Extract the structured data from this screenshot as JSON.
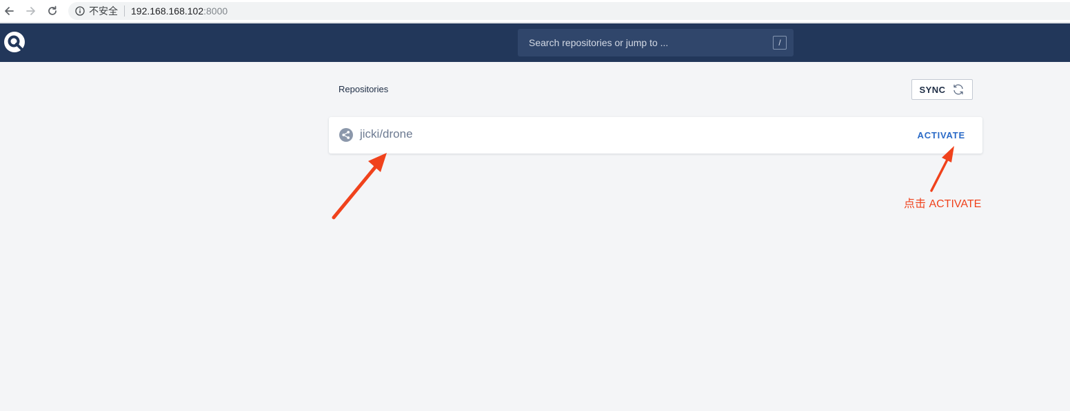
{
  "browser": {
    "security_label": "不安全",
    "host": "192.168.168.102",
    "port": ":8000"
  },
  "header": {
    "search_placeholder": "Search repositories or jump to ...",
    "search_shortcut": "/"
  },
  "main": {
    "title": "Repositories",
    "sync_label": "SYNC",
    "repos": [
      {
        "name": "jicki/drone",
        "action_label": "ACTIVATE"
      }
    ]
  },
  "annotation": {
    "text": "点击 ACTIVATE",
    "color": "#f0421c"
  },
  "colors": {
    "header_bg": "#22375a",
    "accent": "#2a6ac7",
    "page_bg": "#f4f5f7"
  },
  "icons": {
    "back": "arrow-left-icon",
    "forward": "arrow-right-icon",
    "reload": "reload-icon",
    "info": "info-circle-icon",
    "logo": "drone-logo",
    "sync": "refresh-icon",
    "repo": "share-icon"
  }
}
